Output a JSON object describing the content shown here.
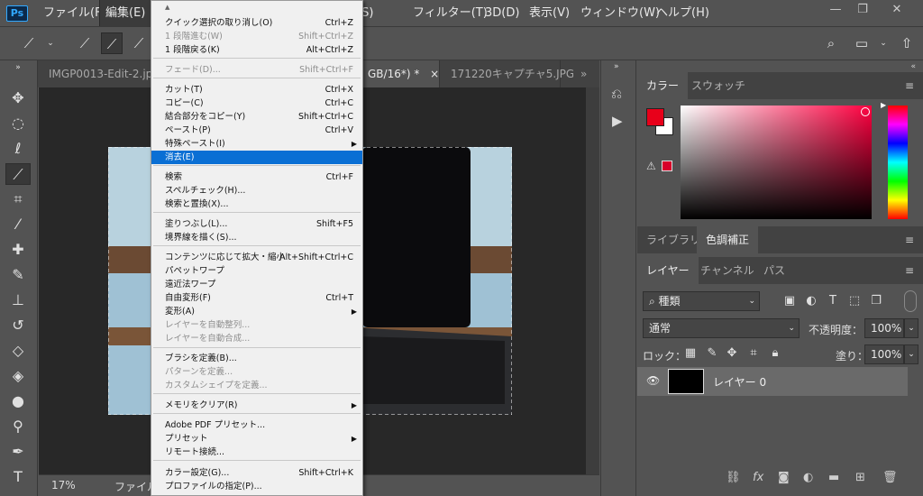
{
  "app": {
    "logo": "Ps"
  },
  "menubar": {
    "items": [
      "ファイル(F)",
      "編集(E)",
      "範囲(S)",
      "フィルター(T)",
      "3D(D)",
      "表示(V)",
      "ウィンドウ(W)",
      "ヘルプ(H)"
    ]
  },
  "tabs": [
    {
      "label": "IMGP0013-Edit-2.jp"
    },
    {
      "label": "GB/16*) *"
    },
    {
      "label": "171220キャプチャ5.JPG"
    }
  ],
  "status": {
    "zoom": "17%",
    "label": "ファイル"
  },
  "edit_menu": {
    "items": [
      {
        "label": "クイック選択の取り消し(O)",
        "shortcut": "Ctrl+Z",
        "disabled": false
      },
      {
        "label": "1 段階進む(W)",
        "shortcut": "Shift+Ctrl+Z",
        "disabled": true
      },
      {
        "label": "1 段階戻る(K)",
        "shortcut": "Alt+Ctrl+Z",
        "disabled": false
      },
      {
        "label": "フェード(D)...",
        "shortcut": "Shift+Ctrl+F",
        "disabled": true
      },
      {
        "label": "カット(T)",
        "shortcut": "Ctrl+X",
        "disabled": false
      },
      {
        "label": "コピー(C)",
        "shortcut": "Ctrl+C",
        "disabled": false
      },
      {
        "label": "結合部分をコピー(Y)",
        "shortcut": "Shift+Ctrl+C",
        "disabled": false
      },
      {
        "label": "ペースト(P)",
        "shortcut": "Ctrl+V",
        "disabled": false
      },
      {
        "label": "特殊ペースト(I)",
        "shortcut": "",
        "disabled": false
      },
      {
        "label": "消去(E)",
        "shortcut": "",
        "disabled": false
      },
      {
        "label": "検索",
        "shortcut": "Ctrl+F",
        "disabled": false
      },
      {
        "label": "スペルチェック(H)...",
        "shortcut": "",
        "disabled": false
      },
      {
        "label": "検索と置換(X)...",
        "shortcut": "",
        "disabled": false
      },
      {
        "label": "塗りつぶし(L)...",
        "shortcut": "Shift+F5",
        "disabled": false
      },
      {
        "label": "境界線を描く(S)...",
        "shortcut": "",
        "disabled": false
      },
      {
        "label": "コンテンツに応じて拡大・縮小",
        "shortcut": "Alt+Shift+Ctrl+C",
        "disabled": false
      },
      {
        "label": "パペットワープ",
        "shortcut": "",
        "disabled": false
      },
      {
        "label": "遠近法ワープ",
        "shortcut": "",
        "disabled": false
      },
      {
        "label": "自由変形(F)",
        "shortcut": "Ctrl+T",
        "disabled": false
      },
      {
        "label": "変形(A)",
        "shortcut": "",
        "disabled": false
      },
      {
        "label": "レイヤーを自動整列...",
        "shortcut": "",
        "disabled": true
      },
      {
        "label": "レイヤーを自動合成...",
        "shortcut": "",
        "disabled": true
      },
      {
        "label": "ブラシを定義(B)...",
        "shortcut": "",
        "disabled": false
      },
      {
        "label": "パターンを定義...",
        "shortcut": "",
        "disabled": true
      },
      {
        "label": "カスタムシェイプを定義...",
        "shortcut": "",
        "disabled": true
      },
      {
        "label": "メモリをクリア(R)",
        "shortcut": "",
        "disabled": false
      },
      {
        "label": "Adobe PDF プリセット...",
        "shortcut": "",
        "disabled": false
      },
      {
        "label": "プリセット",
        "shortcut": "",
        "disabled": false
      },
      {
        "label": "リモート接続...",
        "shortcut": "",
        "disabled": false
      },
      {
        "label": "カラー設定(G)...",
        "shortcut": "Shift+Ctrl+K",
        "disabled": false
      },
      {
        "label": "プロファイルの指定(P)...",
        "shortcut": "",
        "disabled": false
      }
    ]
  },
  "color_panel": {
    "tabs": [
      "カラー",
      "スウォッチ"
    ],
    "foreground": "#e8001a",
    "background": "#ffffff",
    "hue": "#ff0040"
  },
  "lib_panel": {
    "tabs": [
      "ライブラリ",
      "色調補正"
    ]
  },
  "layers_panel": {
    "tabs": [
      "レイヤー",
      "チャンネル",
      "パス"
    ],
    "filter": "種類",
    "blend_mode": "通常",
    "opacity_label": "不透明度：",
    "opacity": "100%",
    "lock_label": "ロック：",
    "fill_label": "塗り：",
    "fill": "100%",
    "layers": [
      {
        "name": "レイヤー 0"
      }
    ]
  }
}
